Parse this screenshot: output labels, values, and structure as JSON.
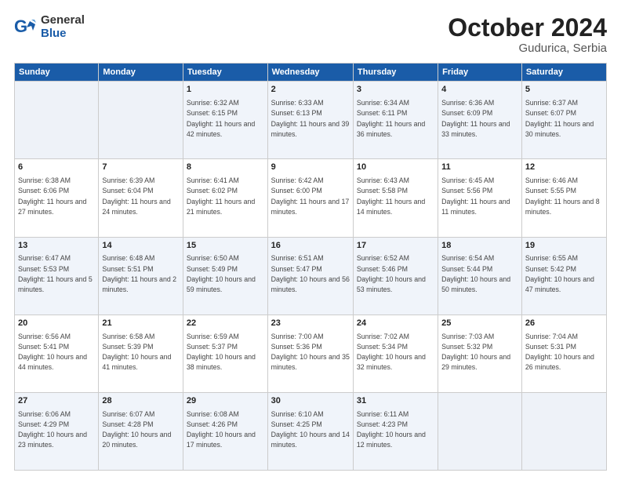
{
  "header": {
    "logo_general": "General",
    "logo_blue": "Blue",
    "month_title": "October 2024",
    "location": "Gudurica, Serbia"
  },
  "weekdays": [
    "Sunday",
    "Monday",
    "Tuesday",
    "Wednesday",
    "Thursday",
    "Friday",
    "Saturday"
  ],
  "weeks": [
    [
      {
        "day": "",
        "info": ""
      },
      {
        "day": "",
        "info": ""
      },
      {
        "day": "1",
        "info": "Sunrise: 6:32 AM\nSunset: 6:15 PM\nDaylight: 11 hours and 42 minutes."
      },
      {
        "day": "2",
        "info": "Sunrise: 6:33 AM\nSunset: 6:13 PM\nDaylight: 11 hours and 39 minutes."
      },
      {
        "day": "3",
        "info": "Sunrise: 6:34 AM\nSunset: 6:11 PM\nDaylight: 11 hours and 36 minutes."
      },
      {
        "day": "4",
        "info": "Sunrise: 6:36 AM\nSunset: 6:09 PM\nDaylight: 11 hours and 33 minutes."
      },
      {
        "day": "5",
        "info": "Sunrise: 6:37 AM\nSunset: 6:07 PM\nDaylight: 11 hours and 30 minutes."
      }
    ],
    [
      {
        "day": "6",
        "info": "Sunrise: 6:38 AM\nSunset: 6:06 PM\nDaylight: 11 hours and 27 minutes."
      },
      {
        "day": "7",
        "info": "Sunrise: 6:39 AM\nSunset: 6:04 PM\nDaylight: 11 hours and 24 minutes."
      },
      {
        "day": "8",
        "info": "Sunrise: 6:41 AM\nSunset: 6:02 PM\nDaylight: 11 hours and 21 minutes."
      },
      {
        "day": "9",
        "info": "Sunrise: 6:42 AM\nSunset: 6:00 PM\nDaylight: 11 hours and 17 minutes."
      },
      {
        "day": "10",
        "info": "Sunrise: 6:43 AM\nSunset: 5:58 PM\nDaylight: 11 hours and 14 minutes."
      },
      {
        "day": "11",
        "info": "Sunrise: 6:45 AM\nSunset: 5:56 PM\nDaylight: 11 hours and 11 minutes."
      },
      {
        "day": "12",
        "info": "Sunrise: 6:46 AM\nSunset: 5:55 PM\nDaylight: 11 hours and 8 minutes."
      }
    ],
    [
      {
        "day": "13",
        "info": "Sunrise: 6:47 AM\nSunset: 5:53 PM\nDaylight: 11 hours and 5 minutes."
      },
      {
        "day": "14",
        "info": "Sunrise: 6:48 AM\nSunset: 5:51 PM\nDaylight: 11 hours and 2 minutes."
      },
      {
        "day": "15",
        "info": "Sunrise: 6:50 AM\nSunset: 5:49 PM\nDaylight: 10 hours and 59 minutes."
      },
      {
        "day": "16",
        "info": "Sunrise: 6:51 AM\nSunset: 5:47 PM\nDaylight: 10 hours and 56 minutes."
      },
      {
        "day": "17",
        "info": "Sunrise: 6:52 AM\nSunset: 5:46 PM\nDaylight: 10 hours and 53 minutes."
      },
      {
        "day": "18",
        "info": "Sunrise: 6:54 AM\nSunset: 5:44 PM\nDaylight: 10 hours and 50 minutes."
      },
      {
        "day": "19",
        "info": "Sunrise: 6:55 AM\nSunset: 5:42 PM\nDaylight: 10 hours and 47 minutes."
      }
    ],
    [
      {
        "day": "20",
        "info": "Sunrise: 6:56 AM\nSunset: 5:41 PM\nDaylight: 10 hours and 44 minutes."
      },
      {
        "day": "21",
        "info": "Sunrise: 6:58 AM\nSunset: 5:39 PM\nDaylight: 10 hours and 41 minutes."
      },
      {
        "day": "22",
        "info": "Sunrise: 6:59 AM\nSunset: 5:37 PM\nDaylight: 10 hours and 38 minutes."
      },
      {
        "day": "23",
        "info": "Sunrise: 7:00 AM\nSunset: 5:36 PM\nDaylight: 10 hours and 35 minutes."
      },
      {
        "day": "24",
        "info": "Sunrise: 7:02 AM\nSunset: 5:34 PM\nDaylight: 10 hours and 32 minutes."
      },
      {
        "day": "25",
        "info": "Sunrise: 7:03 AM\nSunset: 5:32 PM\nDaylight: 10 hours and 29 minutes."
      },
      {
        "day": "26",
        "info": "Sunrise: 7:04 AM\nSunset: 5:31 PM\nDaylight: 10 hours and 26 minutes."
      }
    ],
    [
      {
        "day": "27",
        "info": "Sunrise: 6:06 AM\nSunset: 4:29 PM\nDaylight: 10 hours and 23 minutes."
      },
      {
        "day": "28",
        "info": "Sunrise: 6:07 AM\nSunset: 4:28 PM\nDaylight: 10 hours and 20 minutes."
      },
      {
        "day": "29",
        "info": "Sunrise: 6:08 AM\nSunset: 4:26 PM\nDaylight: 10 hours and 17 minutes."
      },
      {
        "day": "30",
        "info": "Sunrise: 6:10 AM\nSunset: 4:25 PM\nDaylight: 10 hours and 14 minutes."
      },
      {
        "day": "31",
        "info": "Sunrise: 6:11 AM\nSunset: 4:23 PM\nDaylight: 10 hours and 12 minutes."
      },
      {
        "day": "",
        "info": ""
      },
      {
        "day": "",
        "info": ""
      }
    ]
  ]
}
